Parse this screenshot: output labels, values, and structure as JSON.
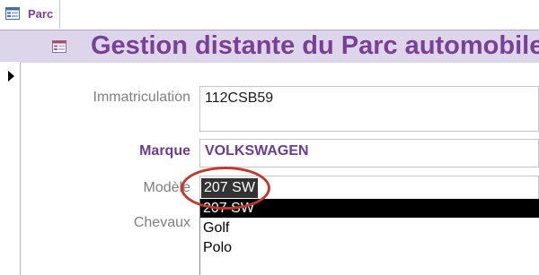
{
  "tab": {
    "label": "Parc",
    "icon": "form-icon"
  },
  "header": {
    "title": "Gestion distante du Parc automobile",
    "icon": "form-icon"
  },
  "form": {
    "immatriculation": {
      "label": "Immatriculation",
      "value": "112CSB59"
    },
    "marque": {
      "label": "Marque",
      "value": "VOLKSWAGEN"
    },
    "modele": {
      "label": "Modèle",
      "value": "207 SW",
      "options": [
        "207 SW",
        "Golf",
        "Polo"
      ]
    },
    "chevaux": {
      "label": "Chevaux"
    }
  },
  "colors": {
    "accent": "#7a3f97",
    "header_bg": "#ddd5e9",
    "annotation": "#c0392b"
  }
}
